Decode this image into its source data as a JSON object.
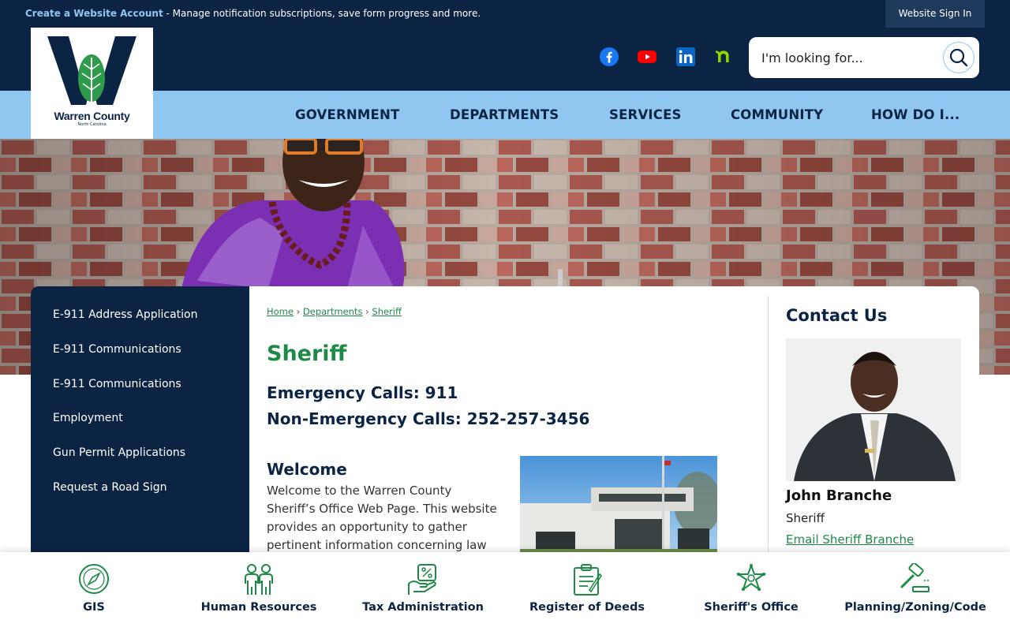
{
  "topbar": {
    "create_account": "Create a Website Account",
    "message": " - Manage notification subscriptions, save form progress and more.",
    "signin": "Website Sign In"
  },
  "logo": {
    "name": "Warren County",
    "sub": "North Carolina"
  },
  "social": [
    "facebook-icon",
    "youtube-icon",
    "linkedin-icon",
    "nextdoor-icon"
  ],
  "search": {
    "placeholder": "I'm looking for..."
  },
  "nav": [
    "GOVERNMENT",
    "DEPARTMENTS",
    "SERVICES",
    "COMMUNITY",
    "HOW DO I..."
  ],
  "sidebar": [
    "E-911 Address Application",
    "E-911 Communications",
    "E-911 Communications",
    "Employment",
    "Gun Permit Applications",
    "Request a Road Sign"
  ],
  "breadcrumb": {
    "home": "Home",
    "sep": "›",
    "departments": "Departments",
    "current": "Sheriff"
  },
  "page": {
    "title": "Sheriff",
    "emergency": "Emergency Calls: 911",
    "non_emergency": "Non-Emergency Calls: 252-257-3456",
    "welcome_title": "Welcome",
    "welcome_text": "Welcome to the Warren County Sheriff’s Office Web Page. This website provides an opportunity to gather pertinent information concerning law"
  },
  "contact": {
    "heading": "Contact Us",
    "name": "John Branche",
    "title": "Sheriff",
    "email": "Email Sheriff Branche"
  },
  "quick_links": [
    "GIS",
    "Human Resources",
    "Tax Administration",
    "Register of Deeds",
    "Sheriff's Office",
    "Planning/Zoning/Code"
  ],
  "colors": {
    "navy": "#0c2444",
    "light_blue": "#8fc7f0",
    "green": "#1e8a45"
  }
}
